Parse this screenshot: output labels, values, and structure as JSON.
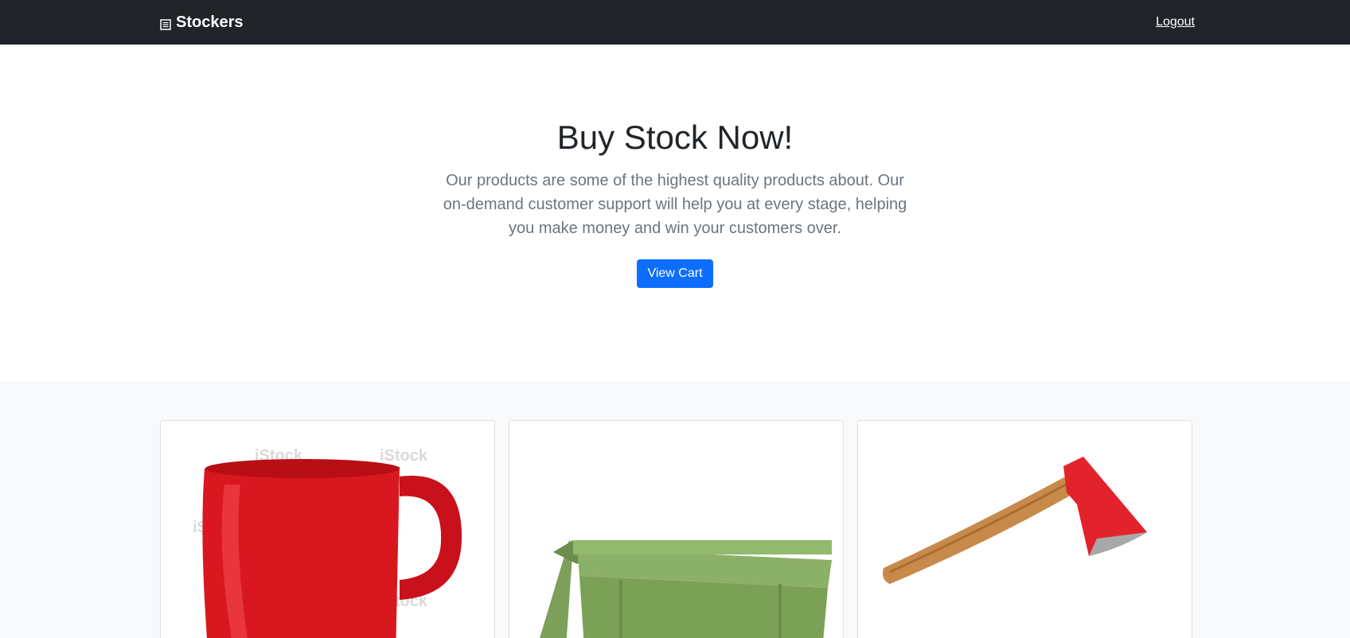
{
  "navbar": {
    "brand": "Stockers",
    "brand_icon": "document-icon",
    "logout_label": "Logout"
  },
  "hero": {
    "title": "Buy Stock Now!",
    "description": "Our products are some of the highest quality products about. Our on-demand customer support will help you at every stage, helping you make money and win your customers over.",
    "cart_button_label": "View Cart"
  },
  "products": [
    {
      "name": "red-mug",
      "watermark": "iStock"
    },
    {
      "name": "green-bin"
    },
    {
      "name": "red-axe"
    }
  ],
  "colors": {
    "navbar": "#212529",
    "primary": "#0d6efd",
    "section_bg": "#f8f9fa"
  }
}
